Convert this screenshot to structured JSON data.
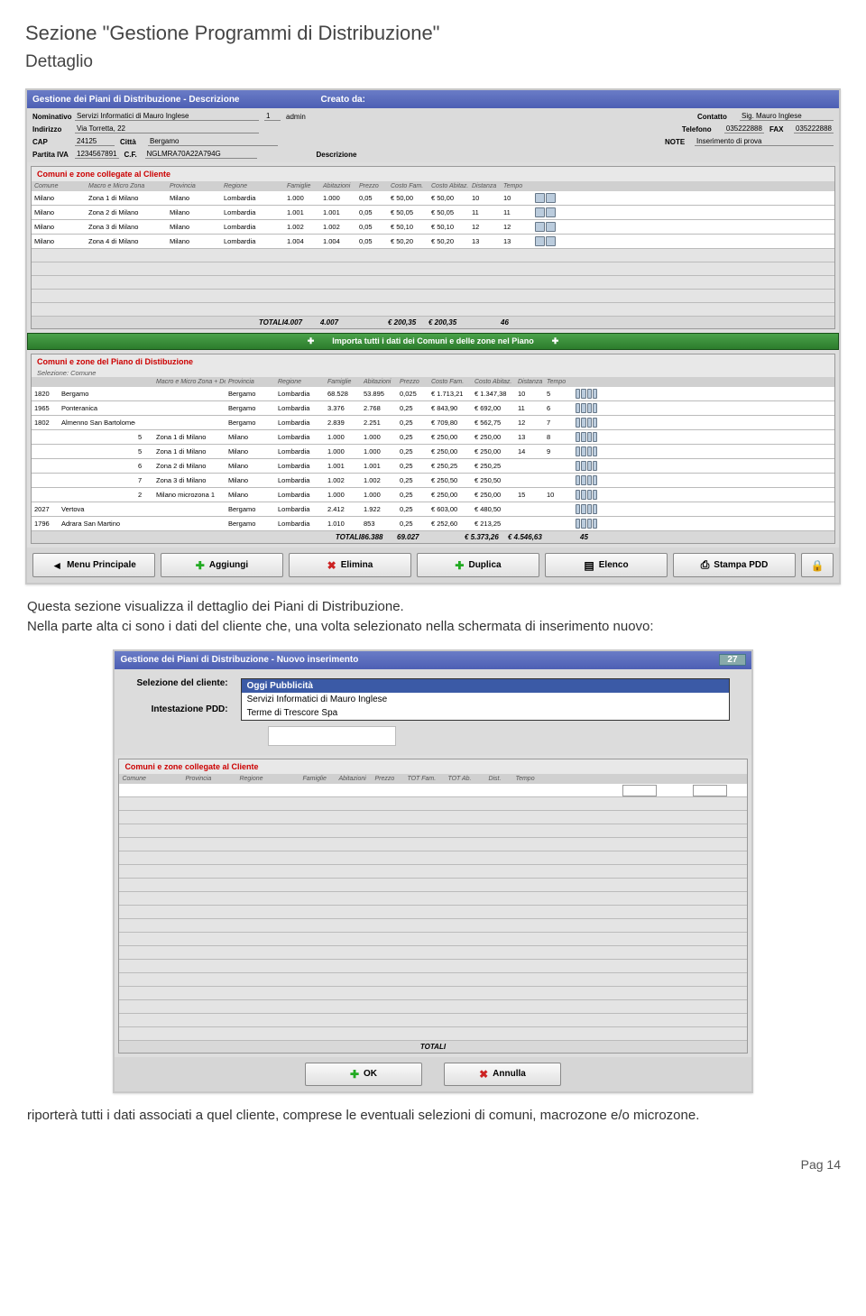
{
  "page": {
    "section_title": "Sezione \"Gestione Programmi di Distribuzione\"",
    "subtitle": "Dettaglio",
    "intro_para": "Questa sezione visualizza il dettaglio dei Piani di Distribuzione.\nNella parte alta ci sono i dati del cliente che, una volta selezionato nella schermata di inserimento nuovo:",
    "closing_para": "riporterà tutti i dati associati a quel cliente, comprese le eventuali selezioni di comuni, macrozone e/o microzone.",
    "page_number": "Pag 14"
  },
  "shot1": {
    "title_left": "Gestione dei Piani di Distribuzione - Descrizione",
    "title_right": "Creato da:",
    "fields": {
      "nominativo_l": "Nominativo",
      "nominativo": "Servizi Informatici di Mauro Inglese",
      "id": "1",
      "admin": "admin",
      "contatto_l": "Contatto",
      "contatto": "Sig. Mauro Inglese",
      "indirizzo_l": "Indirizzo",
      "indirizzo": "Via Torretta, 22",
      "telefono_l": "Telefono",
      "telefono": "035222888",
      "fax_l": "FAX",
      "fax": "035222888",
      "cap_l": "CAP",
      "cap": "24125",
      "citta_l": "Città",
      "citta": "Bergamo",
      "note_l": "NOTE",
      "note": "Inserimento di prova",
      "piva_l": "Partita IVA",
      "piva": "1234567891",
      "cf_l": "C.F.",
      "cf": "NGLMRA70A22A794G",
      "descr_l": "Descrizione"
    },
    "panel1_title": "Comuni e zone collegate al Cliente",
    "panel1_heads": [
      "Comune",
      "Macro e Micro Zona",
      "Provincia",
      "Regione",
      "Famiglie",
      "Abitazioni",
      "Prezzo",
      "Costo Fam.",
      "Costo Abitaz.",
      "Distanza",
      "Tempo",
      ""
    ],
    "panel1_rows": [
      [
        "Milano",
        "Zona 1 di Milano",
        "Milano",
        "Lombardia",
        "1.000",
        "1.000",
        "0,05",
        "€ 50,00",
        "€ 50,00",
        "10",
        "10"
      ],
      [
        "Milano",
        "Zona 2 di Milano",
        "Milano",
        "Lombardia",
        "1.001",
        "1.001",
        "0,05",
        "€ 50,05",
        "€ 50,05",
        "11",
        "11"
      ],
      [
        "Milano",
        "Zona 3 di Milano",
        "Milano",
        "Lombardia",
        "1.002",
        "1.002",
        "0,05",
        "€ 50,10",
        "€ 50,10",
        "12",
        "12"
      ],
      [
        "Milano",
        "Zona 4 di Milano",
        "Milano",
        "Lombardia",
        "1.004",
        "1.004",
        "0,05",
        "€ 50,20",
        "€ 50,20",
        "13",
        "13"
      ]
    ],
    "panel1_totals_lbl": "TOTALI",
    "panel1_totals": [
      "4.007",
      "4.007",
      "",
      "€ 200,35",
      "€ 200,35",
      "",
      "46",
      ""
    ],
    "greenbar": "Importa tutti i dati dei Comuni e delle zone nel Piano",
    "panel2_title": "Comuni e zone del Piano di Distibuzione",
    "panel2_sel": "Selezione: Comune",
    "panel2_heads": [
      "",
      "",
      "",
      "Macro e Micro Zona + Descrizione",
      "Provincia",
      "Regione",
      "Famiglie",
      "Abitazioni",
      "Prezzo",
      "Costo Fam.",
      "Costo Abitaz.",
      "Distanza",
      "Tempo",
      ""
    ],
    "panel2_rows": [
      [
        "1820",
        "Bergamo",
        "",
        "",
        "Bergamo",
        "Lombardia",
        "68.528",
        "53.895",
        "0,025",
        "€ 1.713,21",
        "€ 1.347,38",
        "10",
        "5"
      ],
      [
        "1965",
        "Ponteranica",
        "",
        "",
        "Bergamo",
        "Lombardia",
        "3.376",
        "2.768",
        "0,25",
        "€ 843,90",
        "€ 692,00",
        "11",
        "6"
      ],
      [
        "1802",
        "Almenno San Bartolomeo",
        "",
        "",
        "Bergamo",
        "Lombardia",
        "2.839",
        "2.251",
        "0,25",
        "€ 709,80",
        "€ 562,75",
        "12",
        "7"
      ],
      [
        "",
        "",
        "5",
        "Zona 1 di Milano",
        "Milano",
        "Lombardia",
        "1.000",
        "1.000",
        "0,25",
        "€ 250,00",
        "€ 250,00",
        "13",
        "8"
      ],
      [
        "",
        "",
        "5",
        "Zona 1 di Milano",
        "Milano",
        "Lombardia",
        "1.000",
        "1.000",
        "0,25",
        "€ 250,00",
        "€ 250,00",
        "14",
        "9"
      ],
      [
        "",
        "",
        "6",
        "Zona 2 di Milano",
        "Milano",
        "Lombardia",
        "1.001",
        "1.001",
        "0,25",
        "€ 250,25",
        "€ 250,25",
        "",
        ""
      ],
      [
        "",
        "",
        "7",
        "Zona 3 di Milano",
        "Milano",
        "Lombardia",
        "1.002",
        "1.002",
        "0,25",
        "€ 250,50",
        "€ 250,50",
        "",
        ""
      ],
      [
        "",
        "",
        "2",
        "Milano microzona 1",
        "Milano",
        "Lombardia",
        "1.000",
        "1.000",
        "0,25",
        "€ 250,00",
        "€ 250,00",
        "15",
        "10"
      ],
      [
        "2027",
        "Vertova",
        "",
        "",
        "Bergamo",
        "Lombardia",
        "2.412",
        "1.922",
        "0,25",
        "€ 603,00",
        "€ 480,50",
        "",
        ""
      ],
      [
        "1796",
        "Adrara San Martino",
        "",
        "",
        "Bergamo",
        "Lombardia",
        "1.010",
        "853",
        "0,25",
        "€ 252,60",
        "€ 213,25",
        "",
        ""
      ]
    ],
    "panel2_totals_lbl": "TOTALI",
    "panel2_totals": [
      "86.388",
      "69.027",
      "",
      "€ 5.373,26",
      "€ 4.546,63",
      "",
      "45",
      ""
    ],
    "buttons": {
      "menu": "Menu Principale",
      "add": "Aggiungi",
      "del": "Elimina",
      "dup": "Duplica",
      "list": "Elenco",
      "print": "Stampa PDD"
    }
  },
  "shot2": {
    "title": "Gestione dei Piani di Distribuzione - Nuovo inserimento",
    "badge": "27",
    "sel_lbl": "Selezione del cliente:",
    "int_lbl": "Intestazione PDD:",
    "options": [
      "Oggi Pubblicità",
      "Servizi Informatici di Mauro Inglese",
      "Terme di Trescore Spa"
    ],
    "panel_title": "Comuni e zone collegate al Cliente",
    "heads": [
      "Comune",
      "Provincia",
      "Regione",
      "Famiglie",
      "Abitazioni",
      "Prezzo",
      "TOT Fam.",
      "TOT Ab.",
      "Dist.",
      "Tempo"
    ],
    "totals": "TOTALI",
    "ok": "OK",
    "cancel": "Annulla"
  }
}
